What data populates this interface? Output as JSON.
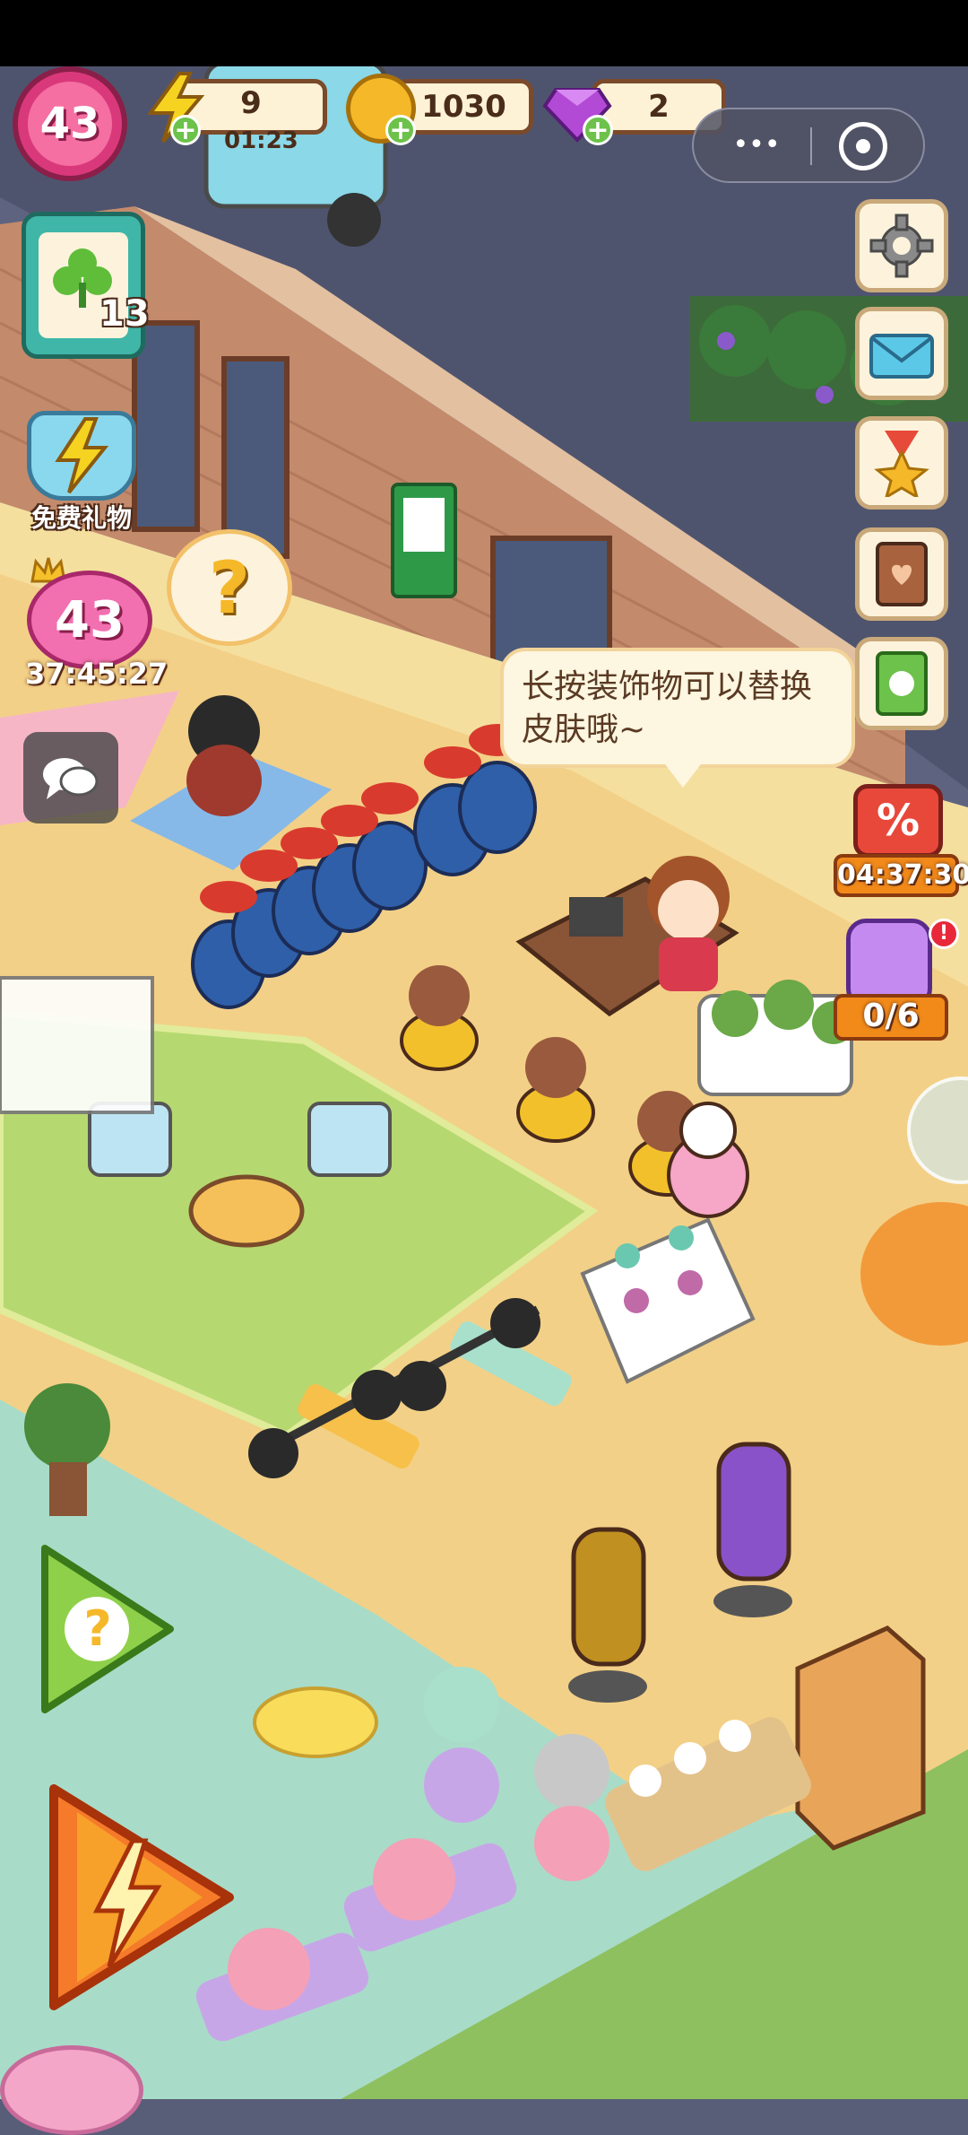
{
  "topbar": {
    "level": "43",
    "energy": {
      "value": "9",
      "timer": "01:23"
    },
    "coins": {
      "value": "1030"
    },
    "gems": {
      "value": "2"
    }
  },
  "miniprogram": {
    "more_glyph": "•••",
    "close_glyph": "◎"
  },
  "left_panel": {
    "clover_count": "13",
    "free_gift_label": "免费礼物",
    "event_level": "43",
    "event_timer": "37:45:27",
    "help_glyph": "?"
  },
  "right_panel": {
    "sale_timer": "04:37:30",
    "jar_progress": "0/6",
    "sale_badge": "%"
  },
  "speech_bubble": {
    "text": "长按装饰物可以替换皮肤哦~"
  },
  "colors": {
    "brand_pink": "#d9397a",
    "coin_gold": "#f5b829",
    "gem_purple": "#b34ad6",
    "green_accent": "#6cc24a",
    "orange_accent": "#f28a1a"
  },
  "icons": [
    "lightning-icon",
    "coin-icon",
    "gem-icon",
    "gear-icon",
    "mail-icon",
    "medal-icon",
    "book-icon",
    "guide-book-icon",
    "chat-icon",
    "question-icon",
    "clover-icon",
    "sale-tag-icon",
    "jar-icon"
  ]
}
